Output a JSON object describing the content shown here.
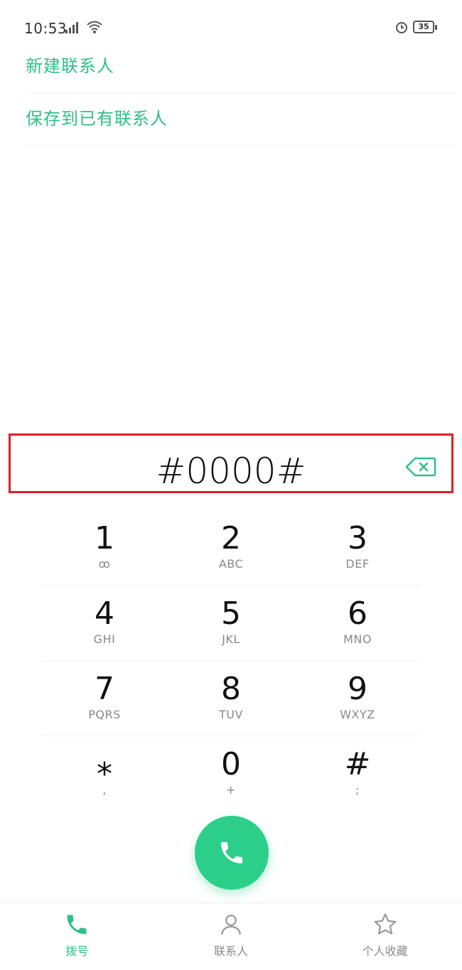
{
  "status_bar": {
    "time": "10:53",
    "battery_level": "35",
    "icons": [
      "signal-icon",
      "wifi-icon",
      "alarm-icon",
      "battery-icon"
    ]
  },
  "menu": {
    "new_contact": "新建联系人",
    "save_to_existing": "保存到已有联系人"
  },
  "dialer": {
    "input_value": "#0000#",
    "backspace_icon": "backspace-icon"
  },
  "keypad": [
    [
      {
        "digit": "1",
        "letters": "ꝏ"
      },
      {
        "digit": "2",
        "letters": "ABC"
      },
      {
        "digit": "3",
        "letters": "DEF"
      }
    ],
    [
      {
        "digit": "4",
        "letters": "GHI"
      },
      {
        "digit": "5",
        "letters": "JKL"
      },
      {
        "digit": "6",
        "letters": "MNO"
      }
    ],
    [
      {
        "digit": "7",
        "letters": "PQRS"
      },
      {
        "digit": "8",
        "letters": "TUV"
      },
      {
        "digit": "9",
        "letters": "WXYZ"
      }
    ],
    [
      {
        "digit": "⁎",
        "letters": ","
      },
      {
        "digit": "0",
        "letters": "+"
      },
      {
        "digit": "#",
        "letters": ";"
      }
    ]
  ],
  "call_button": {
    "icon": "phone-icon"
  },
  "tabs": [
    {
      "label": "拨号",
      "icon": "phone-icon",
      "active": true
    },
    {
      "label": "联系人",
      "icon": "person-icon",
      "active": false
    },
    {
      "label": "个人收藏",
      "icon": "star-icon",
      "active": false
    }
  ],
  "colors": {
    "accent": "#2fbf87",
    "call": "#2ccf8a",
    "highlight_border": "#e31c23"
  }
}
